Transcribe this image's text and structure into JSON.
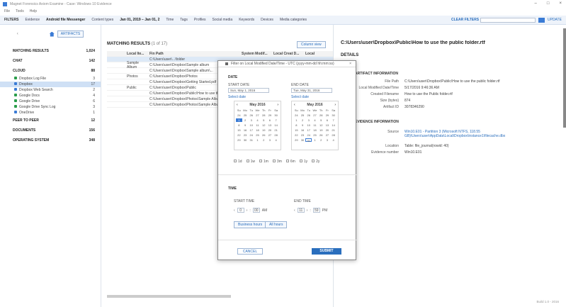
{
  "window": {
    "title": "Magnet Forensics Axiom Examine - Case: Windows 10 Evidence",
    "controls": [
      "–",
      "□",
      "×"
    ]
  },
  "menu": [
    "File",
    "Tools",
    "Help"
  ],
  "filters": {
    "label": "FILTERS",
    "items": [
      "Evidence",
      "Android file Messenger",
      "Content types",
      "Jan 01, 2019 – Jan 01, 2",
      "Time",
      "Tags",
      "Profiles",
      "Social media",
      "Keywords",
      "Devices",
      "Media categories"
    ],
    "clear": "CLEAR FILTERS",
    "update": "UPDATE"
  },
  "left": {
    "artifacts_button": "ARTIFACTS",
    "sections": [
      {
        "label": "MATCHING RESULTS",
        "count": "1,024"
      },
      {
        "label": "CHAT",
        "count": "142"
      },
      {
        "label": "CLOUD",
        "count": "88"
      }
    ],
    "cloud_items": [
      {
        "label": "Dropbox Log File",
        "count": "3",
        "color": "#2a9d4a"
      },
      {
        "label": "Dropbox",
        "count": "17",
        "color": "#3a7bd5",
        "selected": true
      },
      {
        "label": "Dropbox Web Search",
        "count": "2",
        "color": "#3a7bd5"
      },
      {
        "label": "Google Docs",
        "count": "4",
        "color": "#2a9d4a"
      },
      {
        "label": "Google Drive",
        "count": "6",
        "color": "#2a9d4a"
      },
      {
        "label": "Google Drive Sync Log",
        "count": "3",
        "color": "#2a9d4a"
      },
      {
        "label": "OneDrive",
        "count": "1",
        "color": "#3a7bd5"
      }
    ],
    "lower_sections": [
      {
        "label": "PEER TO PEER",
        "count": "12"
      },
      {
        "label": "DOCUMENTS",
        "count": "156"
      },
      {
        "label": "OPERATING SYSTEM",
        "count": "348"
      }
    ]
  },
  "center": {
    "header": "MATCHING RESULTS",
    "header_count": "(1 of 17)",
    "columns": [
      "Local Ite...",
      "Fin Path",
      "System Modif...",
      "Local Creat D...",
      "Local"
    ],
    "rows": [
      {
        "type": "",
        "path": "C:\\Users\\user\\...\\folder",
        "selected": true
      },
      {
        "type": "Sample Album",
        "path": "C:\\Users\\user\\Dropbox\\Sample album"
      },
      {
        "type": "",
        "path": "C:\\Users\\user\\Dropbox\\Sample album\\..."
      },
      {
        "type": "Photos",
        "path": "C:\\Users\\user\\Dropbox\\Photos"
      },
      {
        "type": "",
        "path": "C:\\Users\\user\\Dropbox\\Getting Started.pdf"
      },
      {
        "type": "Public",
        "path": "C:\\Users\\user\\Dropbox\\Public"
      },
      {
        "type": "",
        "path": "C:\\Users\\user\\Dropbox\\Public\\How to use the public folder"
      },
      {
        "type": "",
        "path": "C:\\Users\\user\\Dropbox\\Photos\\Sample Album\\Boston City"
      },
      {
        "type": "",
        "path": "C:\\Users\\user\\Dropbox\\Photos\\Sample Album\\Costa Rican"
      }
    ]
  },
  "dialog": {
    "title": "Filter on Local Modified Date/Time - UTC (yyyy-mm-dd hh:mm:ss)",
    "date_label": "DATE",
    "start_label": "START DATE",
    "end_label": "END DATE",
    "start_value": "Sun, May 1, 2016",
    "end_value": "Tue, May 31, 2016",
    "select_date": "Select date",
    "month_label": "May 2016",
    "weekdays": [
      "Su",
      "Mo",
      "Tu",
      "We",
      "Th",
      "Fr",
      "Sa"
    ],
    "days": [
      "24",
      "25",
      "26",
      "27",
      "28",
      "29",
      "30",
      "1",
      "2",
      "3",
      "4",
      "5",
      "6",
      "7",
      "8",
      "9",
      "10",
      "11",
      "12",
      "13",
      "14",
      "15",
      "16",
      "17",
      "18",
      "19",
      "20",
      "21",
      "22",
      "23",
      "24",
      "25",
      "26",
      "27",
      "28",
      "29",
      "30",
      "31",
      "1",
      "2",
      "3",
      "4"
    ],
    "quick_ranges": [
      "1d",
      "1w",
      "1m",
      "3m",
      "6m",
      "1y",
      "2y"
    ],
    "time_label": "TIME",
    "start_time_label": "START TIME",
    "end_time_label": "END TIME",
    "start_hour": "0",
    "start_min": "00",
    "start_ampm": "AM",
    "end_hour": "11",
    "end_min": "59",
    "end_ampm": "PM",
    "business_hours": "Business hours",
    "after_hours": "All hours",
    "cancel": "CANCEL",
    "submit": "SUBMIT"
  },
  "right": {
    "title": "C:\\Users\\user\\Dropbox\\Public\\How to use the public folder.rtf",
    "details": "DETAILS",
    "type_button": "Column view",
    "artifact_info": "ARTIFACT INFORMATION",
    "fields": [
      {
        "key": "File Path",
        "value": "C:\\Users\\user\\Dropbox\\Public\\How to use the public folder.rtf"
      },
      {
        "key": "Local Modified Date/Time",
        "value": "5/17/2016 9:46:36 AM"
      },
      {
        "key": "Created Filename",
        "value": "How to use the Public folder.rtf"
      },
      {
        "key": "Size (bytes)",
        "value": "874"
      },
      {
        "key": "Artifact ID",
        "value": "3078346290"
      }
    ],
    "evidence_info": "EVIDENCE INFORMATION",
    "ev_fields": [
      {
        "key": "Source",
        "value": "Win10.E01 - Partition 3 (Microsoft NTFS, 118.55 GB)\\Users\\user\\AppData\\Local\\Dropbox\\instance1\\filecache.dbx",
        "link": true
      },
      {
        "key": "Location",
        "value": "Table: file_journal(rowid: 40)"
      },
      {
        "key": "Evidence number",
        "value": "Win10.E01"
      }
    ]
  },
  "footer": "Build 1.0 - 2016"
}
